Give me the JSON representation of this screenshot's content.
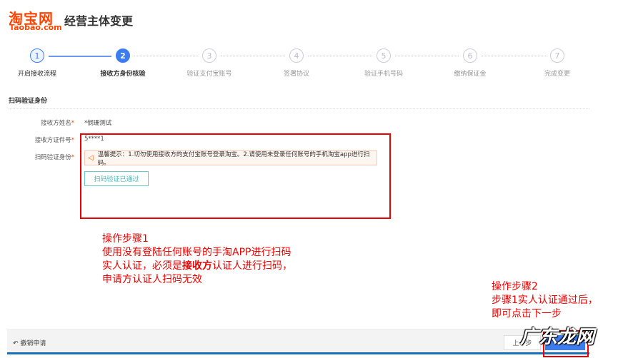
{
  "header": {
    "logo_cn": "淘宝网",
    "logo_en": "Taobao.com",
    "title": "经营主体变更"
  },
  "steps": [
    {
      "num": "1",
      "label": "开启接收流程",
      "state": "done"
    },
    {
      "num": "2",
      "label": "接收方身份核验",
      "state": "current"
    },
    {
      "num": "3",
      "label": "验证支付宝账号",
      "state": "todo"
    },
    {
      "num": "4",
      "label": "签署协议",
      "state": "todo"
    },
    {
      "num": "5",
      "label": "验证手机号码",
      "state": "todo"
    },
    {
      "num": "6",
      "label": "缴纳保证金",
      "state": "todo"
    },
    {
      "num": "7",
      "label": "完成变更",
      "state": "todo"
    }
  ],
  "section": {
    "title": "扫码验证身份"
  },
  "form": {
    "name_label": "接收方姓名",
    "name_value": "*悯珊测试",
    "id_label": "接收方证件号",
    "id_value": "5****1",
    "scan_label": "扫码验证身份",
    "required": "*",
    "tip": "温馨提示：1.切勿使用接收方的支付宝账号登录淘宝。2.请使用未登录任何账号的手机淘宝app进行扫码。",
    "scan_button": "扫码验证已通过"
  },
  "annotation1": {
    "title": "操作步骤1",
    "line1": "使用没有登陆任何账号的手淘APP进行扫码",
    "line2_a": "实人认证，必须是",
    "line2_b": "接收方",
    "line2_c": "认证人进行扫码，",
    "line3": "申请方认证人扫码无效"
  },
  "annotation2": {
    "title": "操作步骤2",
    "line1": "步骤1实人认证通过后，",
    "line2": "即可点击下一步"
  },
  "footer": {
    "revoke": "撤销申请",
    "prev": "上一步",
    "next": ""
  },
  "watermark": "广东龙网",
  "colors": {
    "brand": "#ff4400",
    "primary": "#3b7cf0",
    "annotation": "#ee0000"
  }
}
